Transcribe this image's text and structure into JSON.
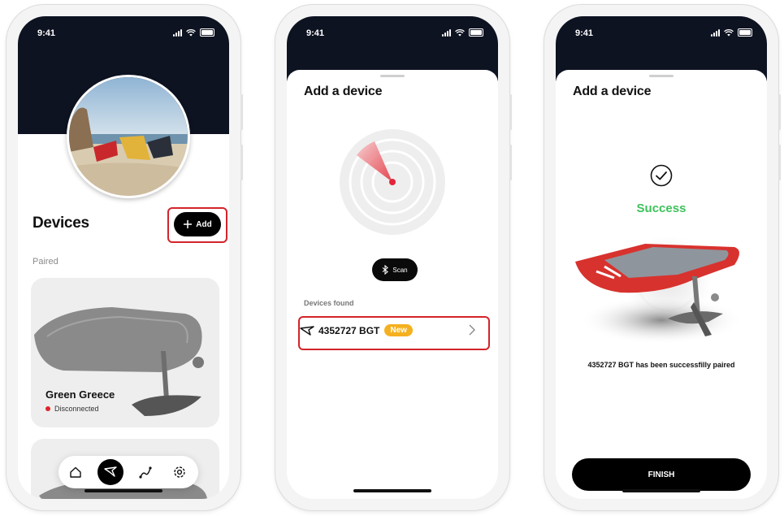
{
  "status_bar": {
    "time": "9:41"
  },
  "devices_screen": {
    "title": "Devices",
    "add_label": "Add",
    "paired_label": "Paired",
    "cards": [
      {
        "name": "Green Greece",
        "status": "Disconnected"
      }
    ],
    "nav": [
      "home-icon",
      "foil-icon",
      "routes-icon",
      "settings-icon"
    ]
  },
  "scan_screen": {
    "title": "Add a device",
    "scan_label": "Scan",
    "found_label": "Devices found",
    "device": {
      "id": "4352727 BGT",
      "badge": "New"
    }
  },
  "success_screen": {
    "title": "Add a device",
    "success_label": "Success",
    "message": "4352727 BGT has been successfilly paired",
    "finish_label": "FINISH"
  },
  "colors": {
    "header_dark": "#0e1322",
    "highlight": "#d3242a",
    "success": "#3dc25a",
    "badge": "#f4b01e",
    "status_red": "#e0242b"
  }
}
